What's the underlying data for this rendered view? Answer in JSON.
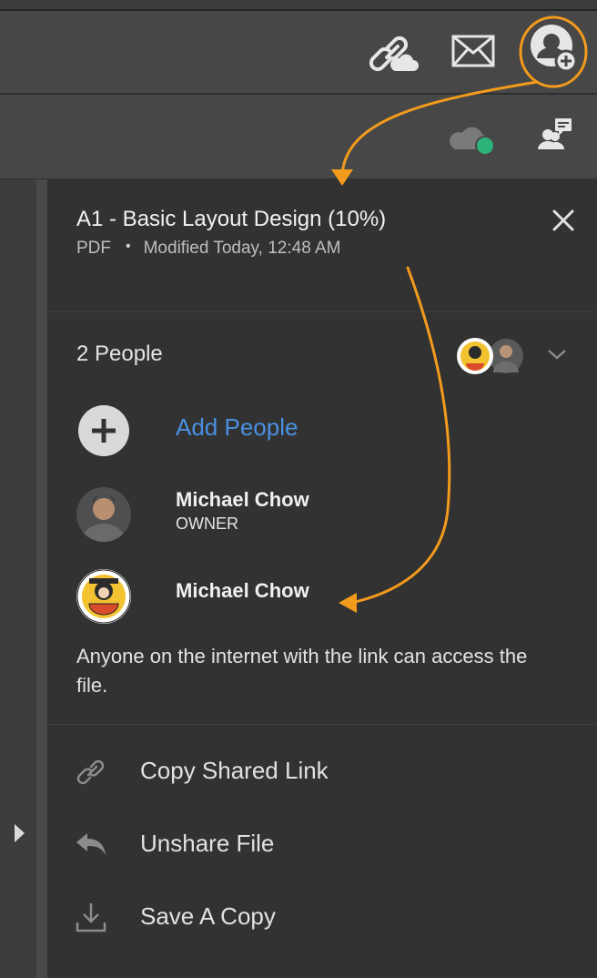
{
  "toolbar": {
    "icons": [
      "link-cloud-icon",
      "envelope-icon",
      "add-user-icon"
    ],
    "secondary_icons": [
      "cloud-sync-icon",
      "comment-people-icon"
    ]
  },
  "file": {
    "title": "A1 - Basic Layout Design (10%)",
    "type": "PDF",
    "separator": "•",
    "modified": "Modified Today, 12:48 AM"
  },
  "people": {
    "count_label": "2 People",
    "add_label": "Add People",
    "members": [
      {
        "name": "Michael Chow",
        "role": "OWNER"
      },
      {
        "name": "Michael Chow",
        "role": ""
      }
    ]
  },
  "access_notice": "Anyone on the internet with the link can access the file.",
  "actions": [
    {
      "label": "Copy Shared Link",
      "icon": "link-icon"
    },
    {
      "label": "Unshare File",
      "icon": "reply-icon"
    },
    {
      "label": "Save A Copy",
      "icon": "download-icon"
    }
  ],
  "colors": {
    "accent_blue": "#4a90e2",
    "annotation_orange": "#f29b1c",
    "sync_green": "#2db37a"
  }
}
